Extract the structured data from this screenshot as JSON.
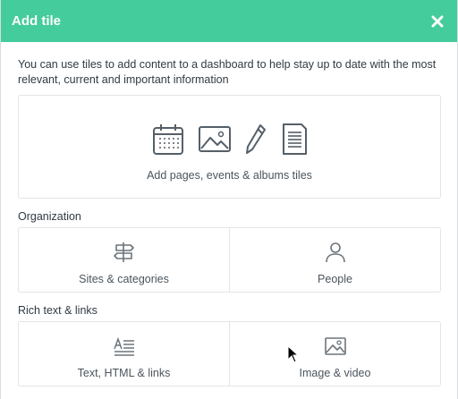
{
  "dialog": {
    "title": "Add tile",
    "close_icon": "close-icon",
    "intro": "You can use tiles to add content to a dashboard to help stay up to date with the most relevant, current and important information"
  },
  "hero": {
    "icons": [
      "calendar-icon",
      "image-icon",
      "pencil-icon",
      "document-icon"
    ],
    "label": "Add pages, events & albums tiles"
  },
  "sections": [
    {
      "title": "Organization",
      "items": [
        {
          "label": "Sites & categories",
          "icon": "signpost-icon"
        },
        {
          "label": "People",
          "icon": "person-icon"
        }
      ]
    },
    {
      "title": "Rich text & links",
      "items": [
        {
          "label": "Text, HTML & links",
          "icon": "text-icon"
        },
        {
          "label": "Image & video",
          "icon": "image-icon"
        }
      ]
    }
  ],
  "colors": {
    "header": "#44cc9c",
    "border": "#e1e5e9",
    "text": "#2f3a44",
    "icon": "#555f68"
  }
}
